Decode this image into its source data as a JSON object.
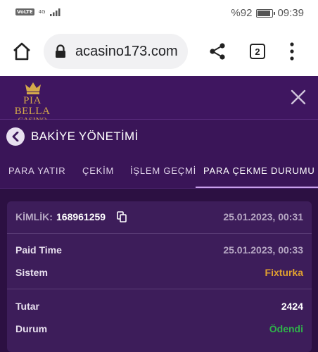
{
  "status_bar": {
    "left_badge": "VoLTE",
    "network": "4G",
    "battery": "%92",
    "battery_level": 0.92,
    "time": "09:39"
  },
  "browser": {
    "url": "acasino173.com",
    "tab_count": "2",
    "icons": [
      "home-icon",
      "lock-icon",
      "share-icon",
      "tabs-icon",
      "menu-icon"
    ]
  },
  "site": {
    "logo_main": "PIA BELLA",
    "logo_sub": "CASINO",
    "close_icon": "close-icon"
  },
  "page": {
    "title": "BAKİYE YÖNETİMİ",
    "back_icon": "chevron-left-icon"
  },
  "tabs": [
    {
      "label": "PARA YATIR"
    },
    {
      "label": "ÇEKİM"
    },
    {
      "label": "İŞLEM GEÇMİŞİ"
    },
    {
      "label": "PARA ÇEKME DURUMU",
      "active": true
    }
  ],
  "card": {
    "id_label": "KİMLİK:",
    "id_value": "168961259",
    "created": "25.01.2023, 00:31",
    "paid_time_label": "Paid Time",
    "paid_time_value": "25.01.2023, 00:33",
    "system_label": "Sistem",
    "system_value": "Fixturka",
    "amount_label": "Tutar",
    "amount_value": "2424",
    "status_label": "Durum",
    "status_value": "Ödendi"
  },
  "colors": {
    "purple_bg": "#3f1660",
    "card_bg": "#3d1d5a",
    "gold": "#e0a030",
    "green": "#2fb24a",
    "grey_text": "#b7a8c4"
  }
}
